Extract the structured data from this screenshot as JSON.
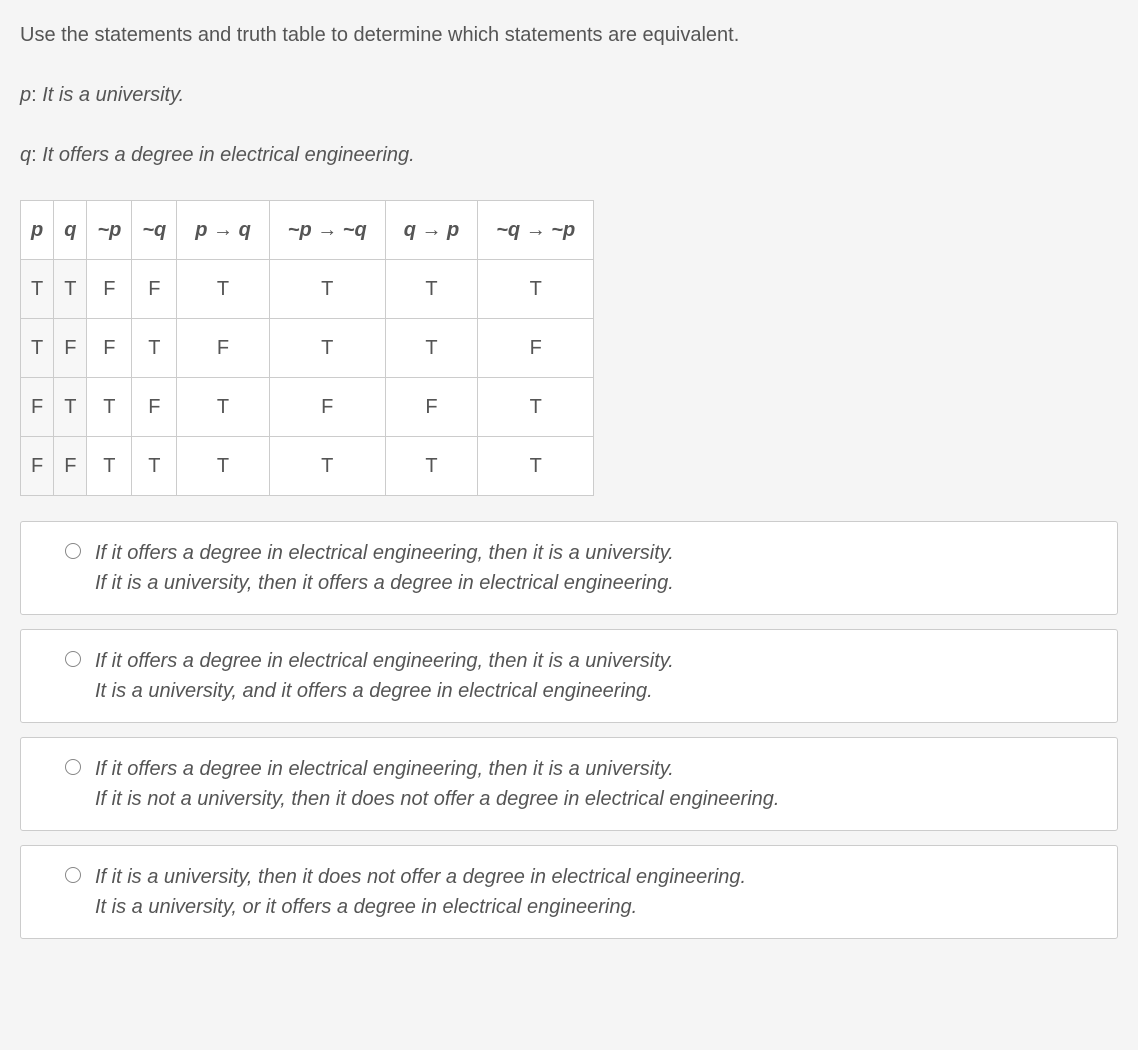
{
  "prompt": "Use the statements and truth table to determine which statements are equivalent.",
  "p_label": "p",
  "p_text": "It is a university.",
  "q_label": "q",
  "q_text": "It offers a degree in electrical engineering.",
  "table": {
    "headers": [
      "p",
      "q",
      "~p",
      "~q",
      "p → q",
      "~p → ~q",
      "q → p",
      "~q → ~p"
    ],
    "rows": [
      [
        "T",
        "T",
        "F",
        "F",
        "T",
        "T",
        "T",
        "T"
      ],
      [
        "T",
        "F",
        "F",
        "T",
        "F",
        "T",
        "T",
        "F"
      ],
      [
        "F",
        "T",
        "T",
        "F",
        "T",
        "F",
        "F",
        "T"
      ],
      [
        "F",
        "F",
        "T",
        "T",
        "T",
        "T",
        "T",
        "T"
      ]
    ]
  },
  "options": [
    {
      "line1": "If it offers a degree in electrical engineering, then it is a university.",
      "line2": "If it is a university, then it offers a degree in electrical engineering."
    },
    {
      "line1": "If it offers a degree in electrical engineering, then it is a university.",
      "line2": "It is a university, and it offers a degree in electrical engineering."
    },
    {
      "line1": "If it offers a degree in electrical engineering, then it is a university.",
      "line2": "If it is not a university, then it does not offer a degree in electrical engineering."
    },
    {
      "line1": "If it is a university, then it does not offer a degree in electrical engineering.",
      "line2": "It is a university, or it offers a degree in electrical engineering."
    }
  ]
}
